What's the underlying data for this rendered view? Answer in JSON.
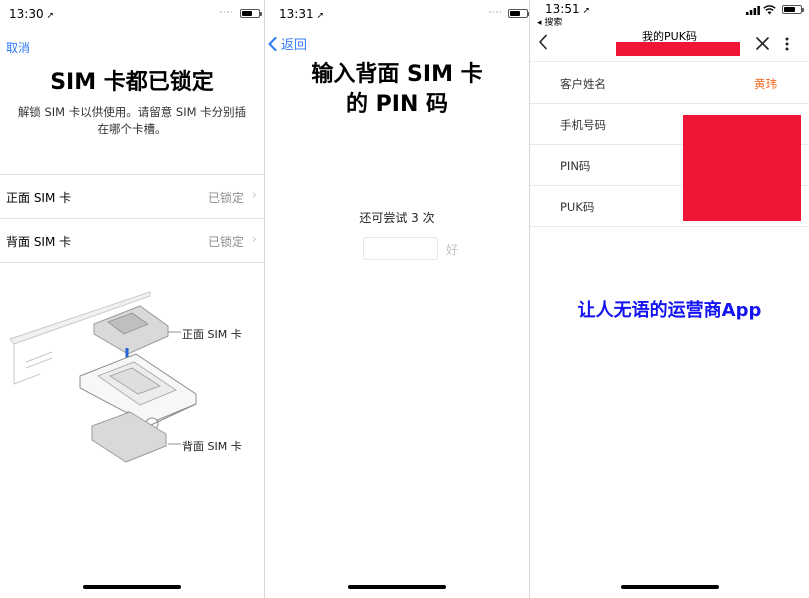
{
  "panel1": {
    "time": "13:30",
    "battery_level": 0.6,
    "cancel": "取消",
    "title": "SIM 卡都已锁定",
    "description_line1": "解锁 SIM 卡以供使用。请留意 SIM 卡分别插",
    "description_line2": "在哪个卡槽。",
    "rows": [
      {
        "label": "正面 SIM 卡",
        "status": "已锁定"
      },
      {
        "label": "背面 SIM 卡",
        "status": "已锁定"
      }
    ],
    "diagram_front_label": "正面 SIM 卡",
    "diagram_back_label": "背面 SIM 卡"
  },
  "panel2": {
    "time": "13:31",
    "battery_level": 0.6,
    "back": "返回",
    "title_line1": "输入背面 SIM 卡",
    "title_line2": "的 PIN 码",
    "attempts": "还可尝试 3 次",
    "ok": "好"
  },
  "panel3": {
    "time": "13:51",
    "battery_level": 0.7,
    "back_app": "◂ 搜索",
    "nav_title": "我的PUK码",
    "rows": [
      {
        "label": "客户姓名",
        "value": "黄玮"
      },
      {
        "label": "手机号码",
        "value": ""
      },
      {
        "label": "PIN码",
        "value": ""
      },
      {
        "label": "PUK码",
        "value": ""
      }
    ],
    "caption": "让人无语的运营商App"
  },
  "colors": {
    "ios_blue": "#2f7bf6",
    "redaction_red": "#f01535",
    "caption_blue": "#1414f2",
    "name_orange": "#f06a23"
  }
}
